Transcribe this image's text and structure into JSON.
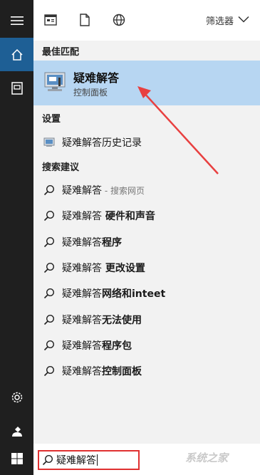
{
  "rail": {
    "items": [
      {
        "icon": "hamburger-menu-icon"
      },
      {
        "icon": "home-icon"
      },
      {
        "icon": "document-icon"
      },
      {
        "icon": "gear-icon"
      },
      {
        "icon": "user-icon"
      },
      {
        "icon": "windows-start-icon"
      }
    ]
  },
  "toolbar": {
    "icons": [
      "apps-icon",
      "documents-icon",
      "web-icon"
    ],
    "filter_label": "筛选器"
  },
  "best_match": {
    "heading": "最佳匹配",
    "title": "疑难解答",
    "subtitle": "控制面板"
  },
  "settings": {
    "heading": "设置",
    "items": [
      {
        "label": "疑难解答历史记录"
      }
    ]
  },
  "suggestions": {
    "heading": "搜索建议",
    "items": [
      {
        "prefix": "疑难解答",
        "bold": "",
        "suffix": " - 搜索网页"
      },
      {
        "prefix": "疑难解答",
        "bold": " 硬件和声音",
        "suffix": ""
      },
      {
        "prefix": "疑难解答",
        "bold": "程序",
        "suffix": ""
      },
      {
        "prefix": "疑难解答",
        "bold": " 更改设置",
        "suffix": ""
      },
      {
        "prefix": "疑难解答",
        "bold": "网络和inteet",
        "suffix": ""
      },
      {
        "prefix": "疑难解答",
        "bold": "无法使用",
        "suffix": ""
      },
      {
        "prefix": "疑难解答",
        "bold": "程序包",
        "suffix": ""
      },
      {
        "prefix": "疑难解答",
        "bold": "控制面板",
        "suffix": ""
      }
    ]
  },
  "search": {
    "value": "疑难解答"
  },
  "watermark": "系统之家",
  "colors": {
    "rail": "#1f1f1f",
    "rail_active": "#1e5f95",
    "panel": "#f2f2f2",
    "best_bg": "#b7d6f2",
    "highlight_border": "#e03030",
    "arrow": "#e84040"
  }
}
